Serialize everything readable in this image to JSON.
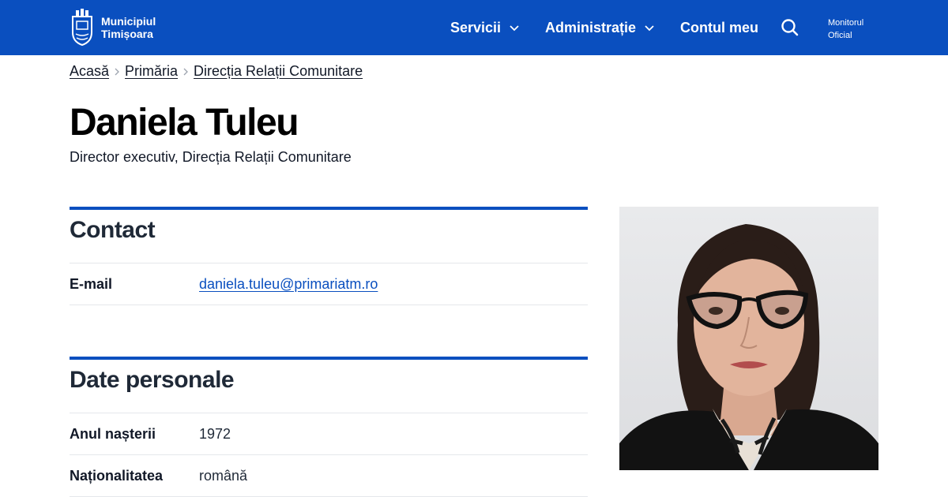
{
  "header": {
    "logo_line1": "Municipiul",
    "logo_line2": "Timișoara",
    "nav": [
      {
        "label": "Servicii"
      },
      {
        "label": "Administrație"
      },
      {
        "label": "Contul meu"
      }
    ],
    "monitor_line1": "Monitorul",
    "monitor_line2": "Oficial",
    "colors": {
      "bar": "#0a4fbf",
      "text": "#ffffff"
    }
  },
  "breadcrumb": [
    "Acasă",
    "Primăria",
    "Direcția Relații Comunitare"
  ],
  "profile": {
    "name": "Daniela Tuleu",
    "role": "Director executiv, Direcția Relații Comunitare"
  },
  "contact": {
    "title": "Contact",
    "rows": [
      {
        "label": "E-mail",
        "value": "daniela.tuleu@primariatm.ro"
      }
    ]
  },
  "personal": {
    "title": "Date personale",
    "rows": [
      {
        "label": "Anul nașterii",
        "value": "1972"
      },
      {
        "label": "Naționalitatea",
        "value": "română"
      }
    ]
  },
  "icons": [
    "city-crest-icon",
    "chevron-down-icon",
    "search-icon",
    "chevron-right-icon"
  ]
}
